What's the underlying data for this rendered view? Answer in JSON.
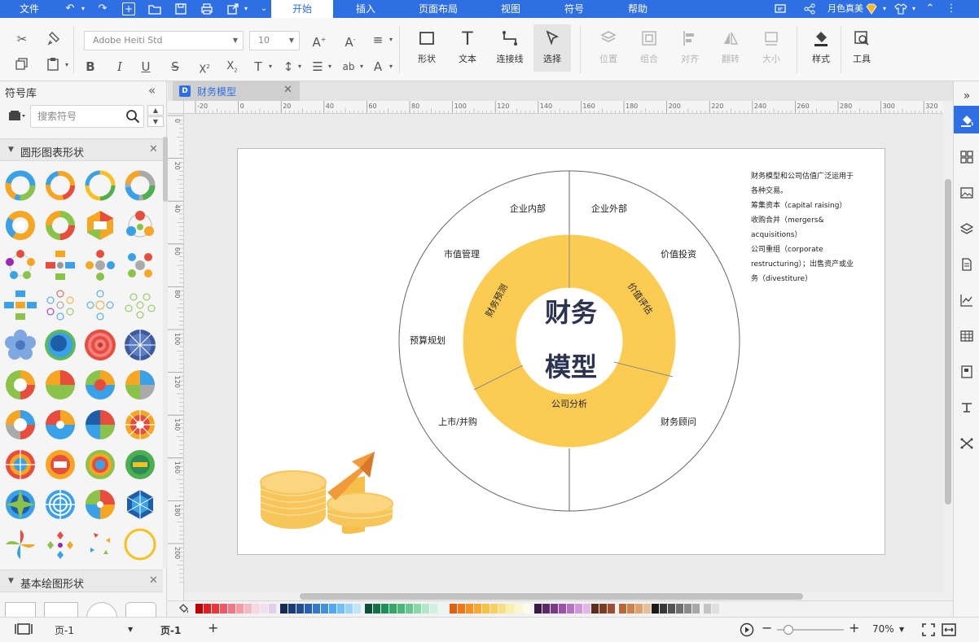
{
  "menu": {
    "file": "文件",
    "tabs": [
      "开始",
      "插入",
      "页面布局",
      "视图",
      "符号",
      "帮助"
    ],
    "active_tab": "开始",
    "user_name": "月色真美"
  },
  "ribbon": {
    "font_family": "Adobe Heiti Std",
    "font_size": "10",
    "buttons": {
      "shape": "形状",
      "text": "文本",
      "connector": "连接线",
      "select": "选择",
      "position": "位置",
      "group": "组合",
      "align": "对齐",
      "flip": "翻转",
      "size": "大小",
      "style": "样式",
      "tools": "工具"
    }
  },
  "left_panel": {
    "title": "符号库",
    "search_placeholder": "搜索符号",
    "section_circle": "圆形图表形状",
    "section_basic": "基本绘图形状"
  },
  "document": {
    "tab_label": "财务模型",
    "tab_icon_letter": "D"
  },
  "ruler": {
    "h_labels": [
      "-20",
      "0",
      "20",
      "40",
      "60",
      "80",
      "100",
      "120",
      "140",
      "160",
      "180",
      "200",
      "220",
      "240",
      "260",
      "280",
      "300",
      "320"
    ],
    "v_labels": [
      "0",
      "20",
      "40",
      "60",
      "80",
      "100",
      "120",
      "140",
      "160",
      "180",
      "200"
    ]
  },
  "diagram": {
    "center_line1": "财务",
    "center_line2": "模型",
    "inner_labels": {
      "budget": "财务预测",
      "valuation": "价值评估",
      "analysis": "公司分析"
    },
    "outer_labels": {
      "internal": "企业内部",
      "external": "企业外部",
      "market_value": "市值管理",
      "value_invest": "价值投资",
      "budget_plan": "预算规划",
      "ipo": "上市/并购",
      "consultant": "财务顾问"
    },
    "colors": {
      "ring": "#fccb52",
      "outline": "#666666",
      "center_text": "#2d3452"
    },
    "notes": [
      "财务模型和公司估值广泛运用于",
      "各种交易。",
      "筹集资本（capital raising）",
      "收购合并（mergers&",
      "acquisitions）",
      "公司重组（corporate",
      "restructuring）；出售资产或业",
      "务（divestiture）"
    ]
  },
  "status": {
    "page_selector": "页-1",
    "page_tab": "页-1",
    "zoom": "70%"
  },
  "palette_colors": [
    "#c00000",
    "#e0201e",
    "#e8383a",
    "#ee5866",
    "#f07888",
    "#f598a8",
    "#f8b8c4",
    "#f8d8e0",
    "#f0e0f0",
    "#e0d0e8",
    "#182858",
    "#1c3a78",
    "#204c98",
    "#2860b8",
    "#3478cc",
    "#4090e0",
    "#50a8f0",
    "#70c0f8",
    "#98d4f8",
    "#c0e4f8",
    "#0c5038",
    "#147048",
    "#1c9058",
    "#30a868",
    "#48b878",
    "#68c890",
    "#88d8a8",
    "#b0e8c8",
    "#d0f0e0",
    "#e8f8f0",
    "#e06010",
    "#f07818",
    "#f89020",
    "#f8a830",
    "#f8c040",
    "#f8d060",
    "#f8e080",
    "#f8f0a8",
    "#f8f8d0",
    "#fffbe8",
    "#3c1848",
    "#5c2868",
    "#7c3888",
    "#9c50a8",
    "#b870c0",
    "#d098d8",
    "#e0b8e8",
    "#5c2c1c",
    "#7c3c24",
    "#9c5030",
    "#b86838",
    "#d08048",
    "#e0a070",
    "#e8c098",
    "#1a1a1a",
    "#383838",
    "#545454",
    "#707070",
    "#8c8c8c",
    "#a8a8a8",
    "#c4c4c4",
    "#e0e0e0"
  ]
}
